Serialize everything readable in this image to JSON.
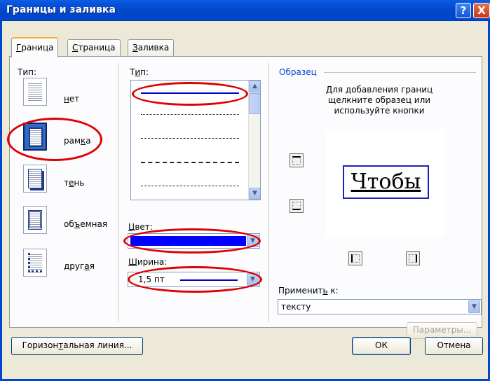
{
  "window": {
    "title": "Границы и заливка",
    "help_glyph": "?",
    "close_glyph": "X"
  },
  "tabs": [
    {
      "pre": "",
      "key": "Г",
      "post": "раница"
    },
    {
      "pre": "",
      "key": "С",
      "post": "траница"
    },
    {
      "pre": "",
      "key": "З",
      "post": "аливка"
    }
  ],
  "setting": {
    "label": "Тип:",
    "items": [
      {
        "pre": "",
        "key": "н",
        "post": "ет"
      },
      {
        "pre": "рам",
        "key": "к",
        "post": "а"
      },
      {
        "pre": "т",
        "key": "е",
        "post": "нь"
      },
      {
        "pre": "об",
        "key": "ъ",
        "post": "емная"
      },
      {
        "pre": "друг",
        "key": "а",
        "post": "я"
      }
    ]
  },
  "style": {
    "pre": "Т",
    "key": "и",
    "post": "п:"
  },
  "color": {
    "pre": "",
    "key": "Ц",
    "post": "вет:",
    "value_color": "#0000ff"
  },
  "width": {
    "pre": "",
    "key": "Ш",
    "post": "ирина:",
    "value": "1,5 пт"
  },
  "preview": {
    "legend": "Образец",
    "hint": "Для добавления границ щелкните образец или используйте кнопки",
    "word": "Чтобы"
  },
  "apply_to": {
    "pre": "Применит",
    "key": "ь",
    "post": " к:",
    "value": "тексту"
  },
  "buttons": {
    "options": "Параметры...",
    "hline": {
      "pre": "Горизон",
      "key": "т",
      "post": "альная линия..."
    },
    "ok": "ОК",
    "cancel": "Отмена"
  },
  "icons": {
    "help": "help-icon",
    "close": "close-icon",
    "arrow_up": "▲",
    "arrow_down": "▼"
  },
  "colors": {
    "annotation": "#e00000",
    "titlebar": "#0047cc",
    "accent": "#316ac5"
  }
}
